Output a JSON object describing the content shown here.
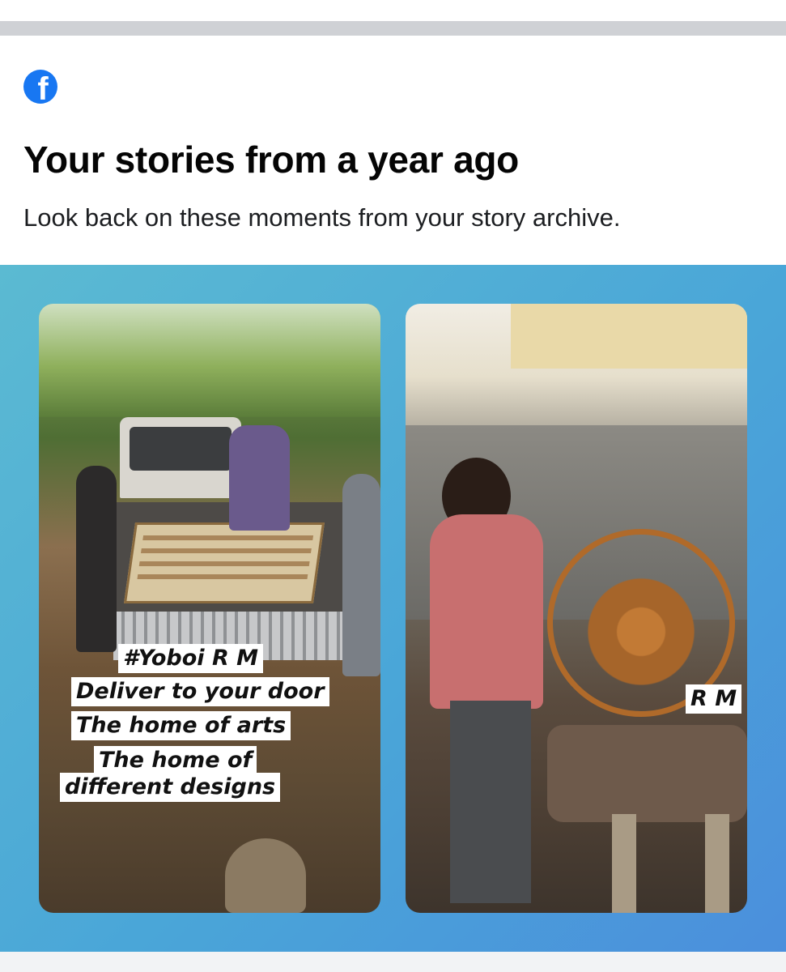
{
  "header": {
    "app_icon": "facebook-logo",
    "app_icon_glyph": "f",
    "title": "Your stories from a year ago",
    "subtitle": "Look back on these moments from your story archive."
  },
  "stories": [
    {
      "captions": [
        "#Yoboi R M",
        "Deliver to your door",
        "The home of arts",
        "The home of",
        "different designs"
      ]
    },
    {
      "captions": [
        "R M"
      ]
    }
  ],
  "colors": {
    "facebook_blue": "#1877f2",
    "panel_gradient_start": "#5bbad2",
    "panel_gradient_end": "#4b8fdc"
  }
}
